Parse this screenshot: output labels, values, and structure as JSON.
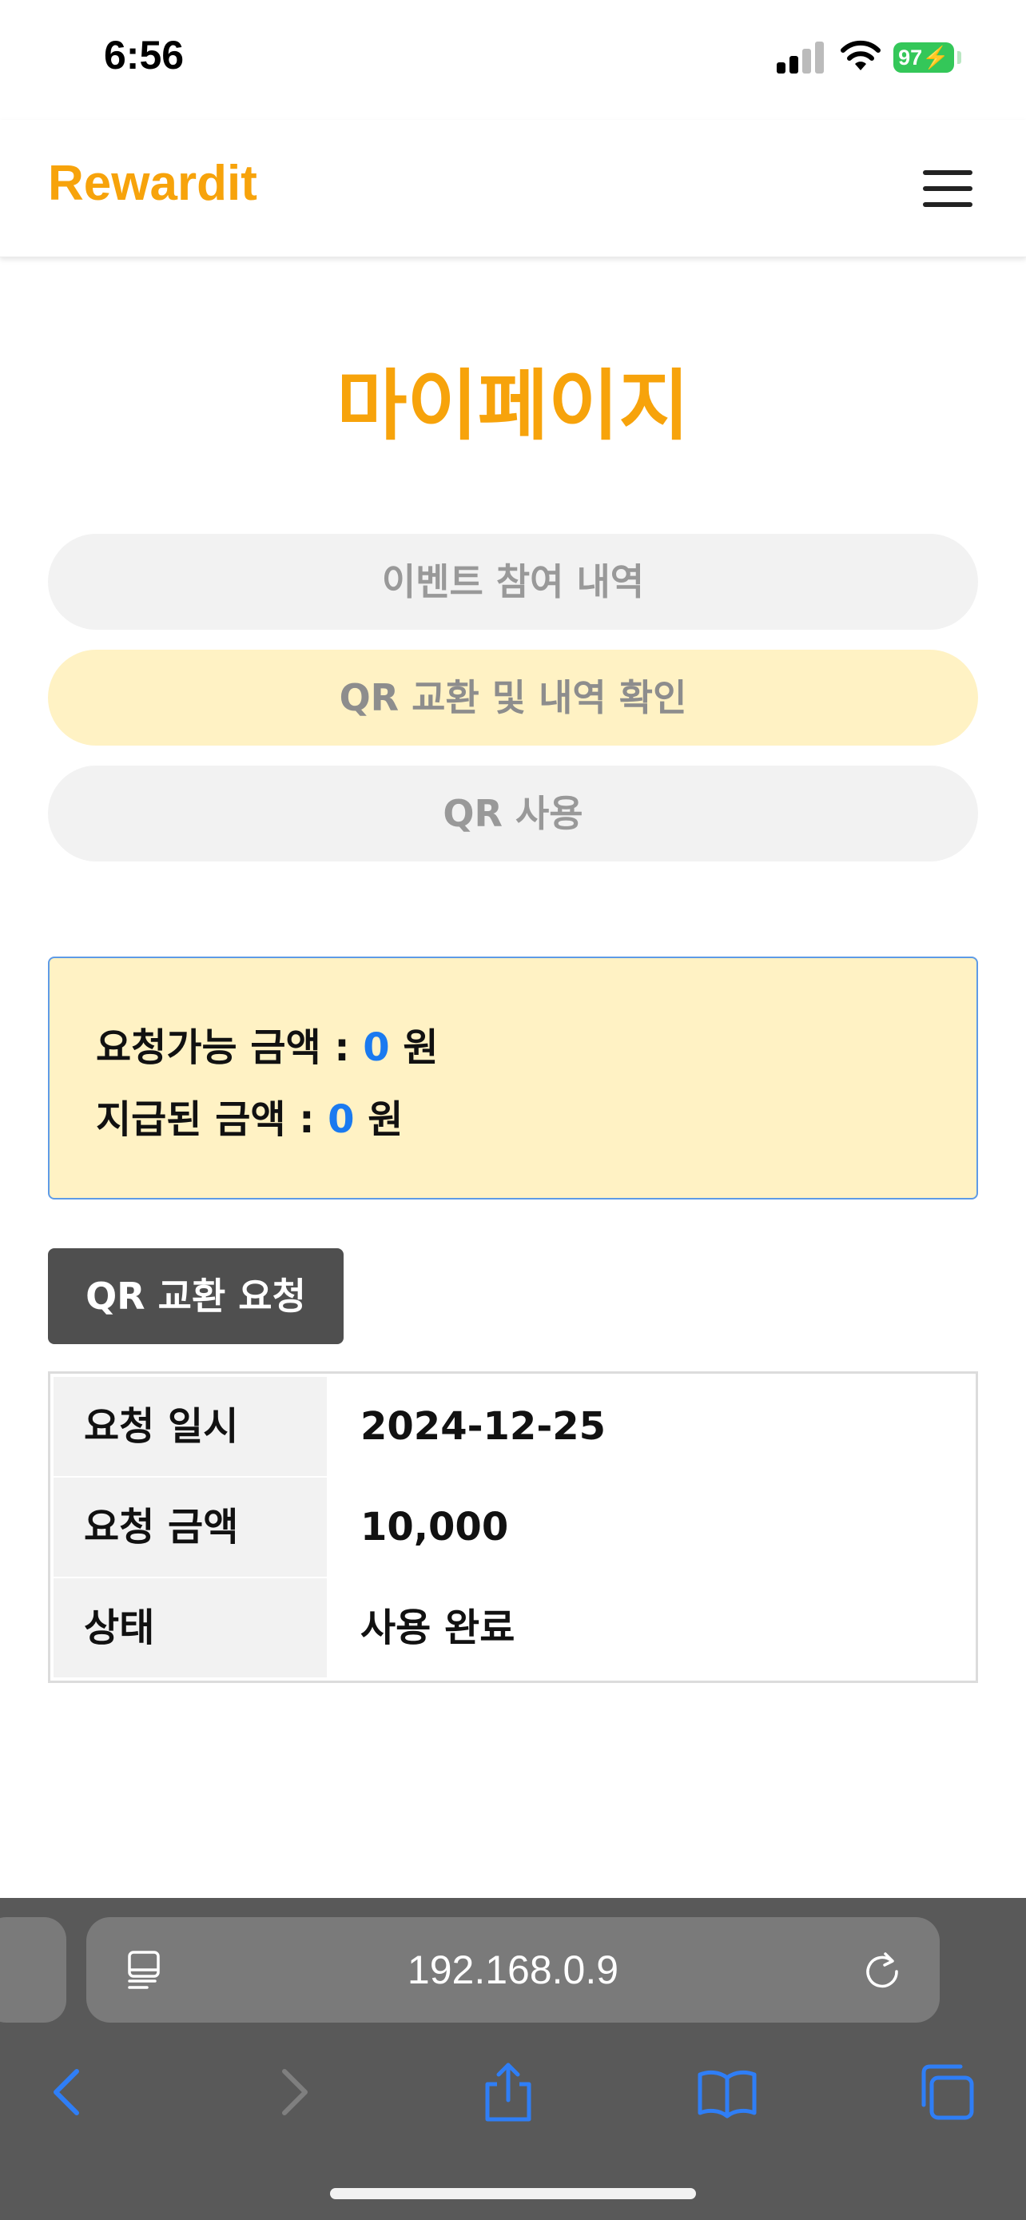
{
  "status_bar": {
    "time": "6:56",
    "battery": "97"
  },
  "header": {
    "brand": "Rewardit",
    "menu_icon": "hamburger-menu-icon"
  },
  "page_title": "마이페이지",
  "tabs": [
    {
      "label": "이벤트 참여 내역",
      "active": false
    },
    {
      "label": "QR 교환 및 내역 확인",
      "active": true
    },
    {
      "label": "QR 사용",
      "active": false
    }
  ],
  "amounts": {
    "requestable_label": "요청가능 금액 : ",
    "requestable_value": "0",
    "paid_label": "지급된 금액 : ",
    "paid_value": "0",
    "unit": " 원"
  },
  "qr_request_button": "QR 교환 요청",
  "request_table": {
    "rows": [
      {
        "label": "요청 일시",
        "value": "2024-12-25"
      },
      {
        "label": "요청 금액",
        "value": "10,000"
      },
      {
        "label": "상태",
        "value": "사용 완료"
      }
    ]
  },
  "browser": {
    "address": "192.168.0.9",
    "icons": [
      "reader-mode-icon",
      "reload-icon",
      "back-icon",
      "forward-icon",
      "share-icon",
      "bookmarks-icon",
      "tabs-icon"
    ]
  },
  "colors": {
    "accent": "#f7a30b",
    "active_tab_bg": "#fff2c4",
    "amount_value": "#1a7af0",
    "button_dark": "#4f4f4f",
    "battery_green": "#34c759",
    "safari_toolbar": "#595959",
    "safari_icon_blue": "#2f7ef6"
  }
}
